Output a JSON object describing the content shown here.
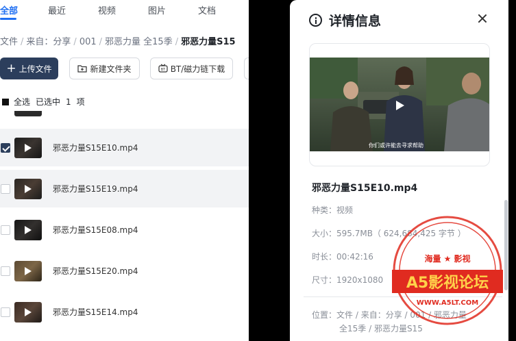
{
  "tabs": [
    {
      "label": "全部",
      "active": true
    },
    {
      "label": "最近",
      "active": false
    },
    {
      "label": "视频",
      "active": false
    },
    {
      "label": "图片",
      "active": false
    },
    {
      "label": "文档",
      "active": false
    }
  ],
  "breadcrumb": [
    "文件",
    "来自：分享",
    "001",
    "邪恶力量 全15季",
    "邪恶力量S15"
  ],
  "toolbar": {
    "upload_label": "上传文件",
    "new_folder_label": "新建文件夹",
    "bt_label": "BT/磁力链下载"
  },
  "selection": {
    "select_all_label": "全选",
    "selected_prefix": "已选中",
    "selected_count": "1",
    "selected_suffix": "项"
  },
  "files": [
    {
      "name": "邪恶力量S15E10.mp4",
      "checked": true
    },
    {
      "name": "邪恶力量S15E19.mp4",
      "checked": false
    },
    {
      "name": "邪恶力量S15E08.mp4",
      "checked": false
    },
    {
      "name": "邪恶力量S15E20.mp4",
      "checked": false
    },
    {
      "name": "邪恶力量S15E14.mp4",
      "checked": false
    }
  ],
  "details": {
    "title": "详情信息",
    "file_name": "邪恶力量S15E10.mp4",
    "video_subtitle": "你们或许能去寻求帮助",
    "type_label": "种类：",
    "type_value": "视频",
    "size_label": "大小：",
    "size_value": "595.7MB（ 624,684,425 字节 ）",
    "duration_label": "时长：",
    "duration_value": "00:42:16",
    "resolution_label": "尺寸：",
    "resolution_value": "1920x1080",
    "location_label": "位置：",
    "location_line1": "文件 / 来自：分享 / 001 / 邪恶力量",
    "location_line2": "全15季 / 邪恶力量S15"
  },
  "watermark": {
    "top_text": "海量 ★ 影视",
    "main_text": "A5影视论坛",
    "url_text": "WWW.A5LT.COM"
  },
  "colors": {
    "accent": "#1f6ff2",
    "primary_button": "#2c3e5c",
    "seal_red": "#e02b20"
  }
}
